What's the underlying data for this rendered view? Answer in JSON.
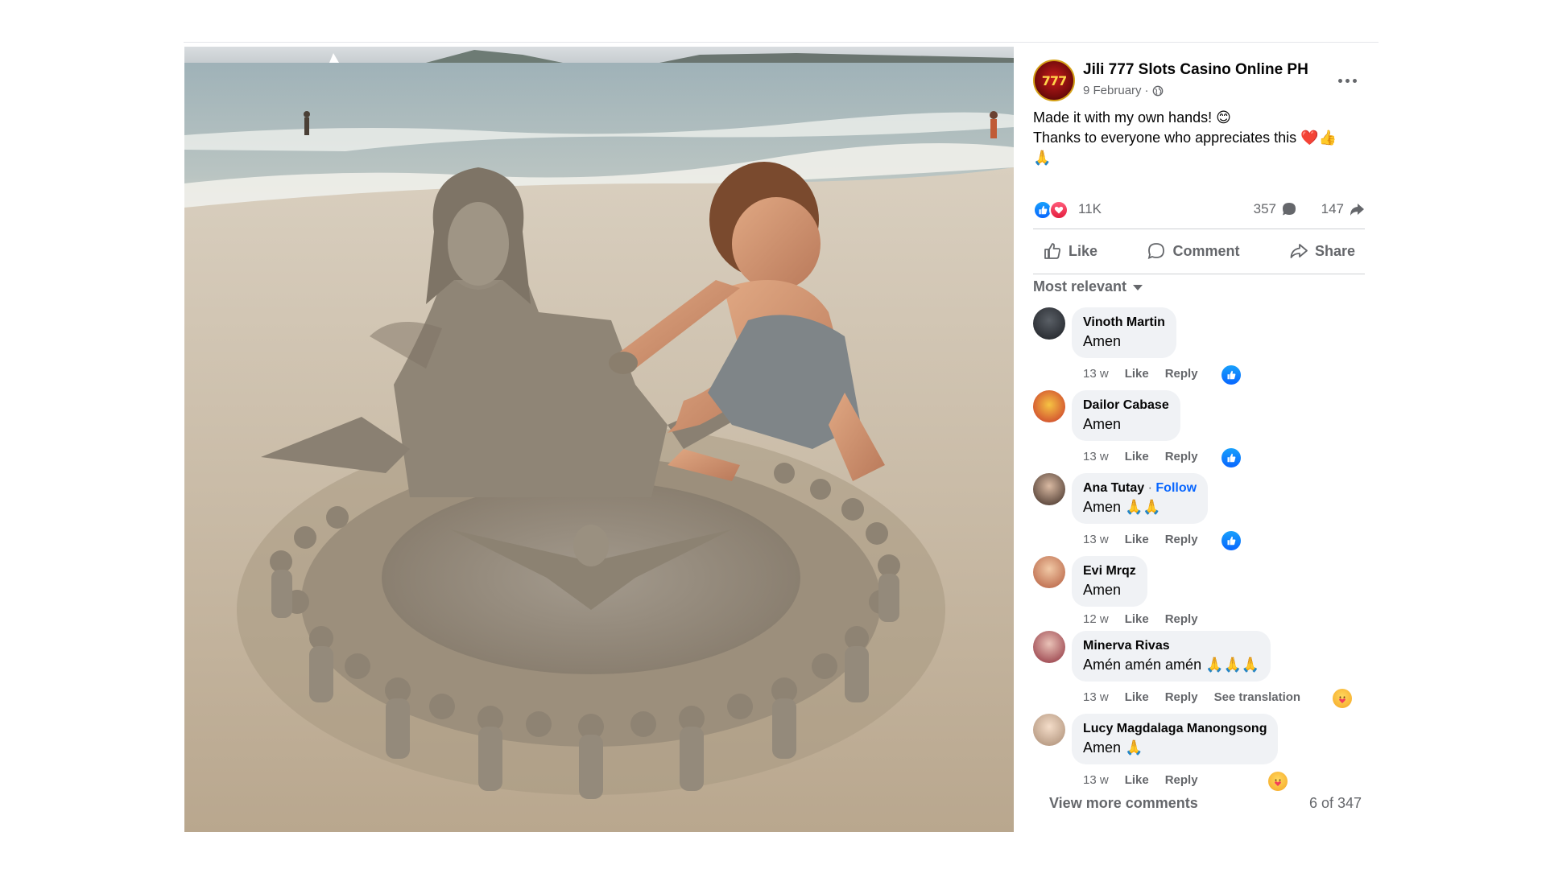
{
  "post": {
    "page_name": "Jili 777 Slots Casino Online PH",
    "avatar_text": "777",
    "date": "9 February",
    "separator": "·",
    "privacy_icon": "globe-icon",
    "more_icon": "more-dots-icon",
    "text_lines": [
      "Made it with my own hands! 😊",
      "Thanks to everyone who appreciates this ❤️👍",
      "🙏"
    ],
    "image_icon": "sand-sculpture-photo"
  },
  "stats": {
    "reaction_icons": [
      "like-reaction-icon",
      "love-reaction-icon"
    ],
    "reactions": "11K",
    "comments": "357",
    "shares": "147"
  },
  "actions": {
    "like": "Like",
    "comment": "Comment",
    "share": "Share"
  },
  "sort": {
    "label": "Most relevant"
  },
  "comments": [
    {
      "name": "Vinoth Martin",
      "text": "Amen",
      "time": "13 w",
      "like": "Like",
      "reply": "Reply",
      "reaction": "like"
    },
    {
      "name": "Dailor Cabase",
      "text": "Amen",
      "time": "13 w",
      "like": "Like",
      "reply": "Reply",
      "reaction": "like"
    },
    {
      "name": "Ana Tutay",
      "follow": "Follow",
      "text": "Amen 🙏🙏",
      "time": "13 w",
      "like": "Like",
      "reply": "Reply",
      "reaction": "like"
    },
    {
      "name": "Evi Mrqz",
      "text": "Amen",
      "time": "12 w",
      "like": "Like",
      "reply": "Reply"
    },
    {
      "name": "Minerva Rivas",
      "text": "Amén amén amén 🙏🙏🙏",
      "time": "13 w",
      "like": "Like",
      "reply": "Reply",
      "translate": "See translation",
      "reaction": "care"
    },
    {
      "name": "Lucy Magdalaga Manongsong",
      "text": "Amen 🙏",
      "time": "13 w",
      "like": "Like",
      "reply": "Reply",
      "reaction": "care"
    }
  ],
  "footer": {
    "view_more": "View more comments",
    "pager": "6 of 347"
  },
  "colors": {
    "accent": "#0866ff",
    "muted_text": "#65676b",
    "bubble": "#f0f2f5",
    "love": "#e41e3f"
  }
}
